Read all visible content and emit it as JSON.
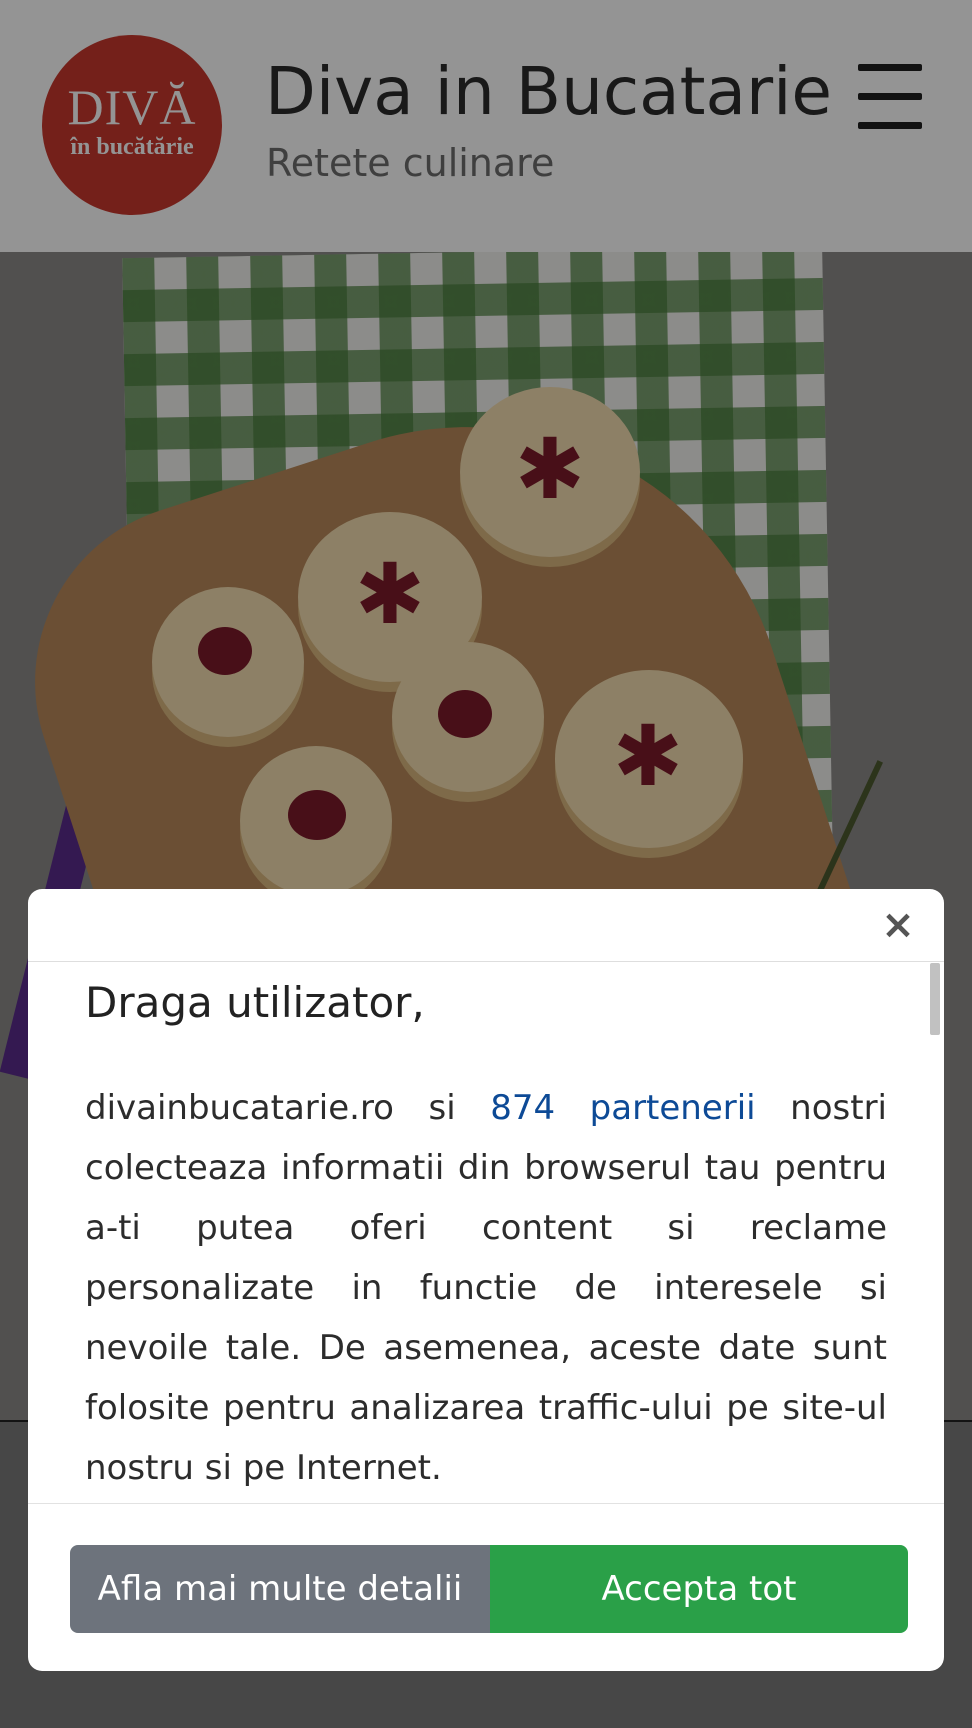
{
  "header": {
    "logo_line1": "DIVĂ",
    "logo_line2": "în bucătărie",
    "title": "Diva in Bucatarie",
    "subtitle": "Retete culinare",
    "menu_icon": "hamburger-menu-icon"
  },
  "hero": {
    "image_subject": "linzer-cookies-photo"
  },
  "consent_modal": {
    "close_icon": "×",
    "heading": "Draga utilizator,",
    "text_before_link": "divainbucatarie.ro si ",
    "link_text": "874 partenerii",
    "text_after_link": " nostri colecteaza informatii din browserul tau pentru a-ti putea oferi content si reclame personalizate in functie de interesele si nevoile tale. De asemenea, aceste date sunt folosite pentru analizarea traffic-ului pe site-ul nostru si pe Internet.",
    "details_button": "Afla mai multe detalii",
    "accept_button": "Accepta tot"
  },
  "colors": {
    "logo_red": "#c9382d",
    "accept_green": "#2aa048",
    "details_gray": "#6d737c",
    "link_blue": "#0d4a96"
  }
}
